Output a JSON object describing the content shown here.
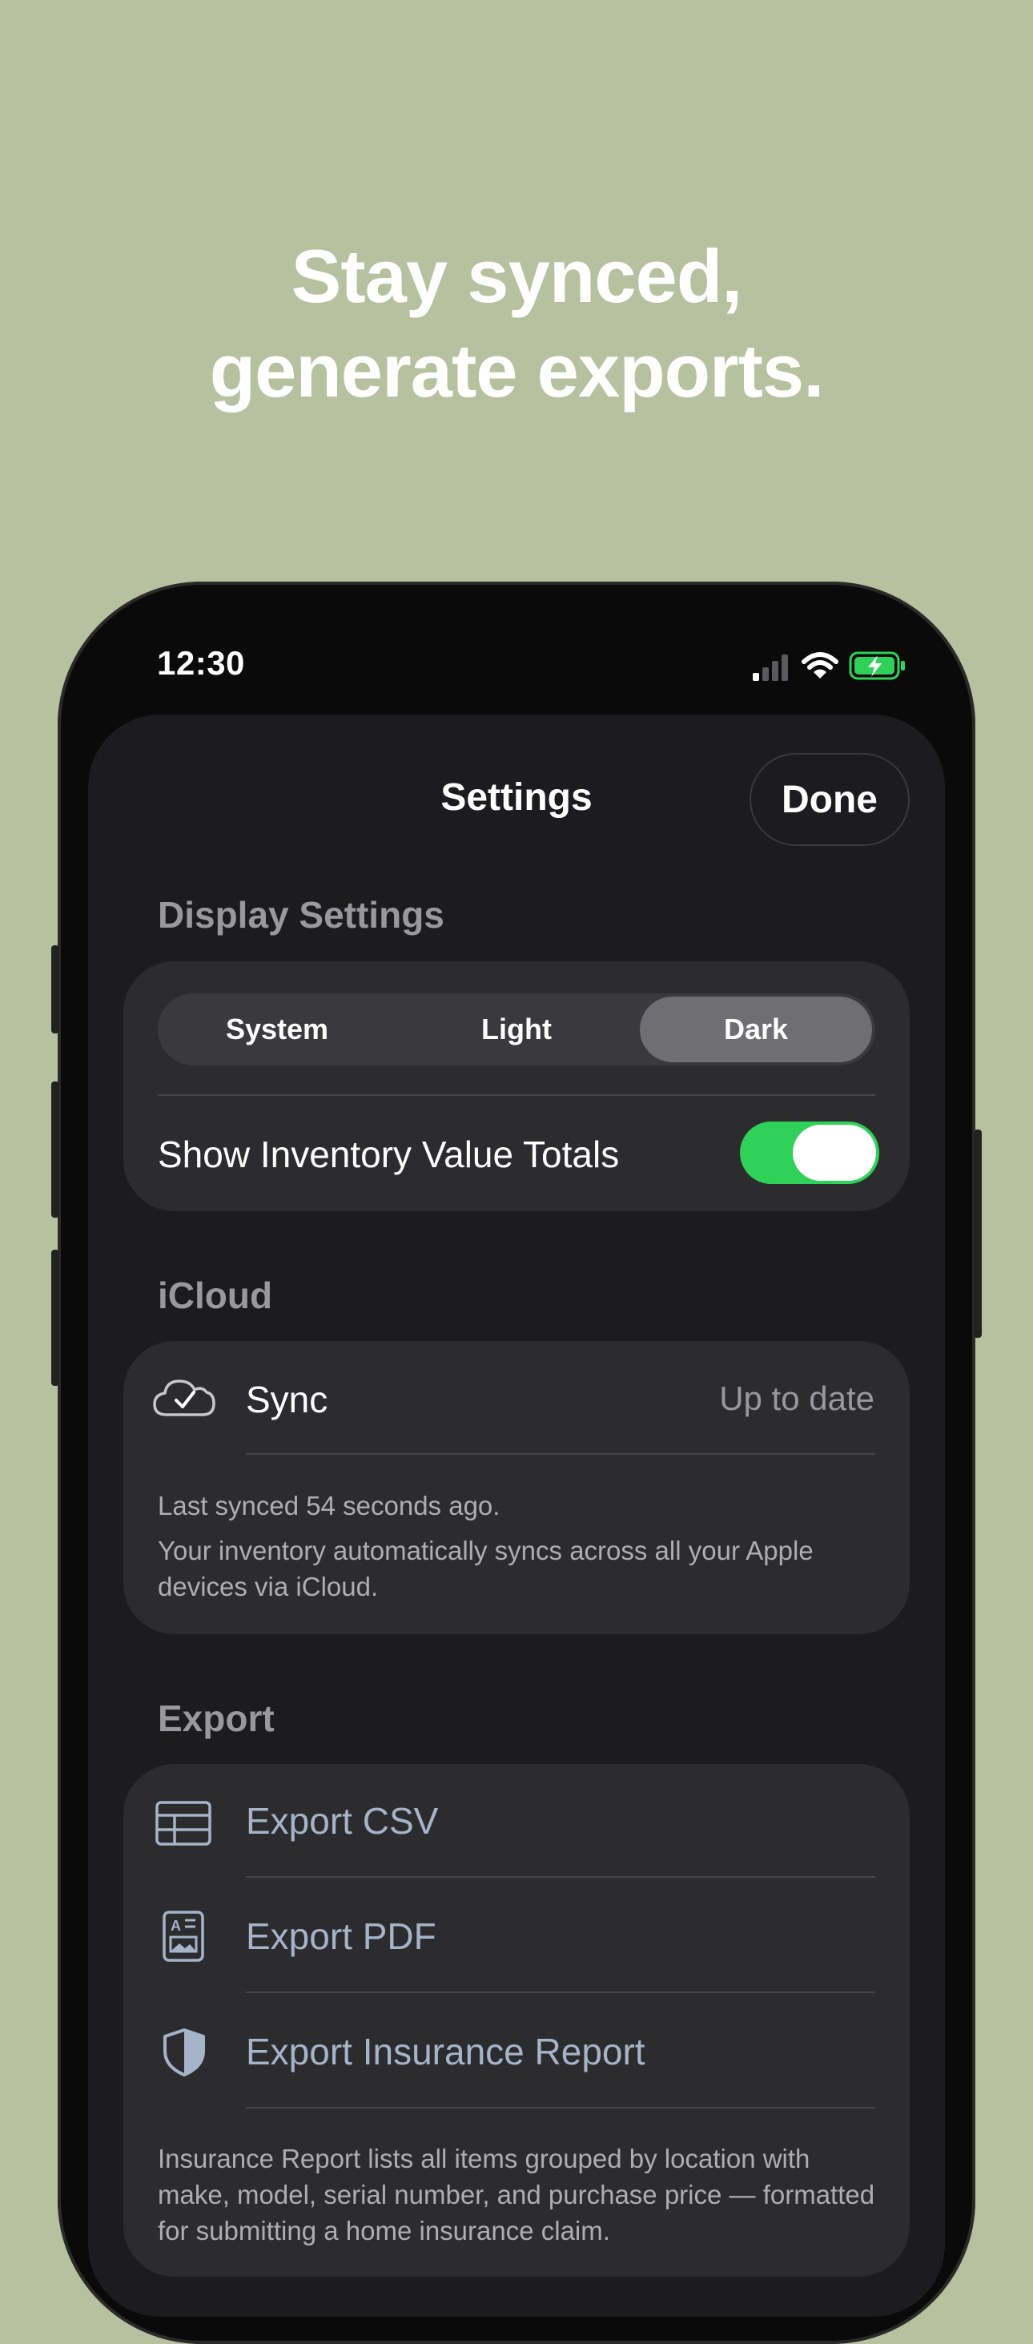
{
  "headline": {
    "line1": "Stay synced,",
    "line2": "generate exports."
  },
  "status_bar": {
    "time": "12:30"
  },
  "nav": {
    "title": "Settings",
    "done_label": "Done"
  },
  "display_settings": {
    "header": "Display Settings",
    "appearance_options": [
      "System",
      "Light",
      "Dark"
    ],
    "selected_appearance": "Dark",
    "toggle_label": "Show Inventory Value Totals",
    "toggle_on": true
  },
  "icloud": {
    "header": "iCloud",
    "sync_label": "Sync",
    "sync_status": "Up to date",
    "last_synced": "Last synced 54 seconds ago.",
    "description": "Your inventory automatically syncs across all your Apple devices via iCloud."
  },
  "export": {
    "header": "Export",
    "items": [
      {
        "label": "Export CSV",
        "icon": "table-icon"
      },
      {
        "label": "Export PDF",
        "icon": "document-icon"
      },
      {
        "label": "Export Insurance Report",
        "icon": "shield-icon"
      }
    ],
    "footnote": "Insurance Report lists all items grouped by location with make, model, serial number, and purchase price — formatted for submitting a home insurance claim."
  },
  "colors": {
    "background": "#b7c09f",
    "sheet": "#1c1c1e",
    "card": "#2c2c2e",
    "toggle_on": "#30d158",
    "export_text": "#a5b4c9"
  }
}
